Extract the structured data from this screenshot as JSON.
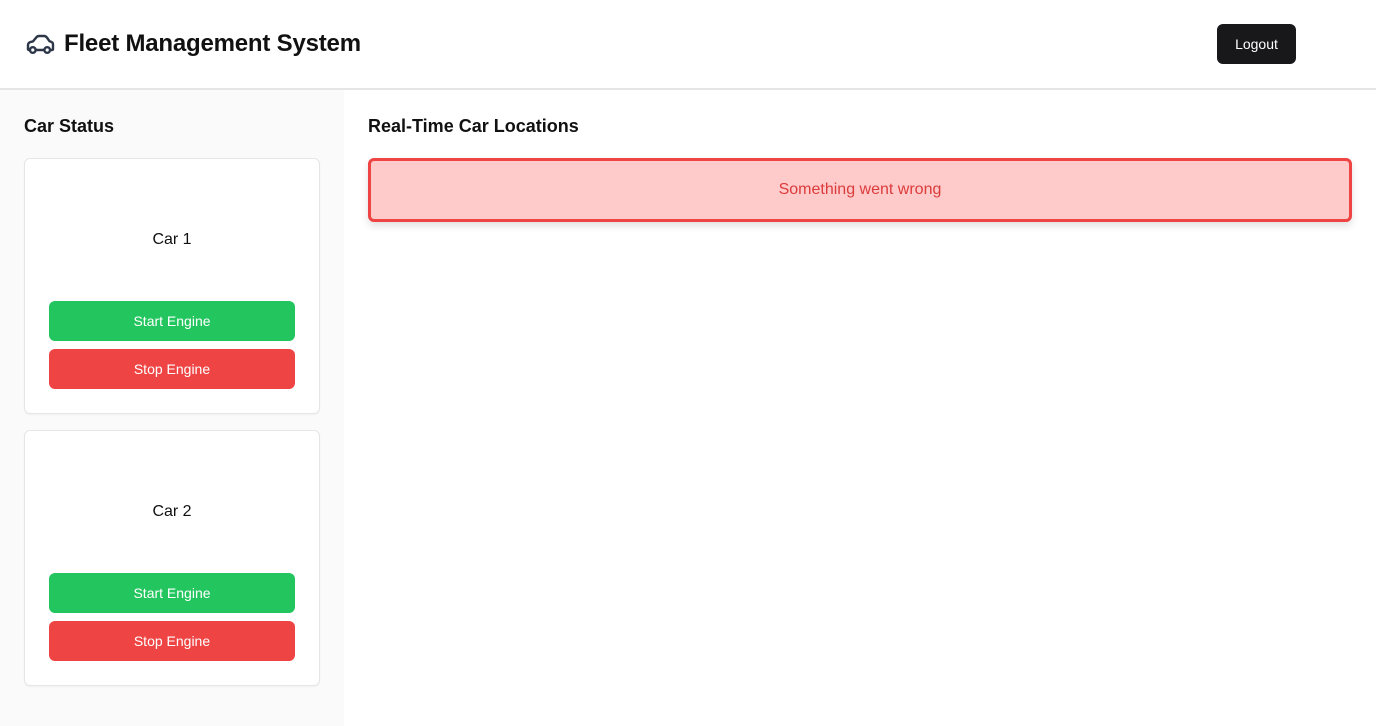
{
  "header": {
    "title": "Fleet Management System",
    "icon": "car-icon",
    "logout_label": "Logout"
  },
  "sidebar": {
    "title": "Car Status",
    "cars": [
      {
        "name": "Car 1",
        "start_label": "Start Engine",
        "stop_label": "Stop Engine"
      },
      {
        "name": "Car 2",
        "start_label": "Start Engine",
        "stop_label": "Stop Engine"
      }
    ]
  },
  "main": {
    "title": "Real-Time Car Locations",
    "error_message": "Something went wrong"
  },
  "colors": {
    "start": "#22c55e",
    "stop": "#ef4444",
    "error_bg": "#fecaca",
    "error_border": "#ef4444",
    "logout_bg": "#18181b"
  }
}
